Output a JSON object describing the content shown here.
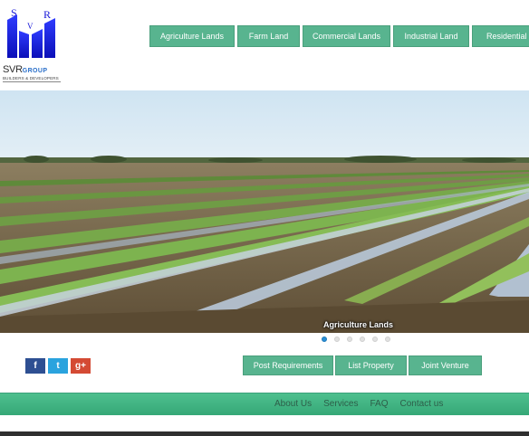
{
  "brand": {
    "logo_letters": [
      "S",
      "V",
      "R"
    ],
    "name": "SVR",
    "group": "GROUP",
    "tagline": "BUILDERS & DEVELOPERS"
  },
  "topnav": {
    "items": [
      {
        "label": "Agriculture Lands"
      },
      {
        "label": "Farm Land"
      },
      {
        "label": "Commercial Lands"
      },
      {
        "label": "Industrial Land"
      },
      {
        "label": "Residential L"
      }
    ]
  },
  "hero": {
    "caption": "Agriculture Lands",
    "slide_count": 6,
    "active_slide": 1
  },
  "social": {
    "facebook": "f",
    "twitter": "t",
    "googleplus": "g+"
  },
  "actions": {
    "items": [
      {
        "label": "Post Requirements"
      },
      {
        "label": "List Property"
      },
      {
        "label": "Joint Venture"
      }
    ]
  },
  "footer": {
    "links": [
      {
        "label": "About Us"
      },
      {
        "label": "Services"
      },
      {
        "label": "FAQ"
      },
      {
        "label": "Contact us"
      }
    ]
  },
  "colors": {
    "accent_green": "#58b48f",
    "footer_green": "#3fb482",
    "logo_blue": "#1a1ad8",
    "slider_active": "#2a8fd6"
  }
}
